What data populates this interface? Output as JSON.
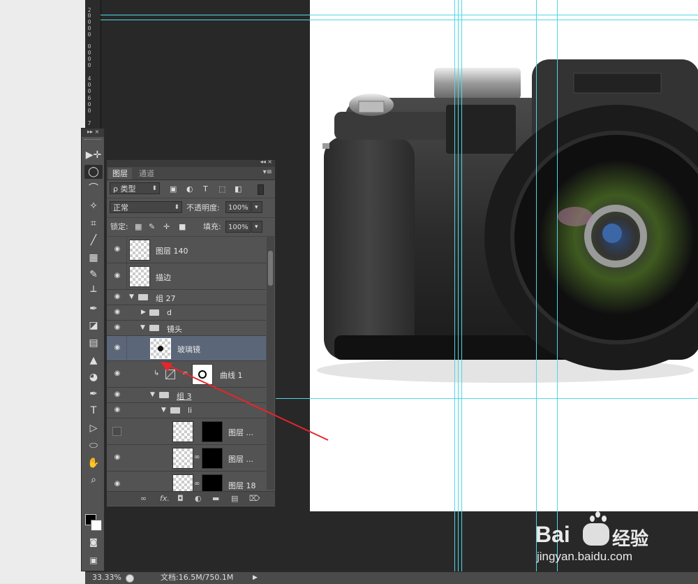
{
  "ruler": {
    "ticks": [
      "2",
      "0",
      "0",
      "0",
      "0",
      "0",
      "0",
      "0",
      "0",
      "4",
      "0",
      "0",
      "6",
      "0",
      "0",
      "7"
    ]
  },
  "tools_panel": {
    "header": "▸▸ ×",
    "tools": [
      {
        "name": "move-tool",
        "glyph": "▶✛"
      },
      {
        "name": "elliptical-marquee-tool",
        "glyph": "◯"
      },
      {
        "name": "lasso-tool",
        "glyph": "⌒"
      },
      {
        "name": "quick-selection-tool",
        "glyph": "✧"
      },
      {
        "name": "crop-tool",
        "glyph": "⌗"
      },
      {
        "name": "eyedropper-tool",
        "glyph": "╱"
      },
      {
        "name": "spot-healing-tool",
        "glyph": "▦"
      },
      {
        "name": "brush-tool",
        "glyph": "✎"
      },
      {
        "name": "clone-stamp-tool",
        "glyph": "┴"
      },
      {
        "name": "history-brush-tool",
        "glyph": "✒"
      },
      {
        "name": "eraser-tool",
        "glyph": "◪"
      },
      {
        "name": "gradient-tool",
        "glyph": "▤"
      },
      {
        "name": "blur-tool",
        "glyph": "▲"
      },
      {
        "name": "dodge-tool",
        "glyph": "◕"
      },
      {
        "name": "pen-tool",
        "glyph": "✒"
      },
      {
        "name": "type-tool",
        "glyph": "T"
      },
      {
        "name": "path-selection-tool",
        "glyph": "▷"
      },
      {
        "name": "ellipse-tool",
        "glyph": "⬭"
      },
      {
        "name": "hand-tool",
        "glyph": "✋"
      },
      {
        "name": "zoom-tool",
        "glyph": "⌕"
      }
    ]
  },
  "layers_panel": {
    "collapse": "◂◂ ×",
    "tabs": [
      "图层",
      "通道"
    ],
    "menu": "▾≡",
    "filter": {
      "label": "ρ 类型",
      "arrow": "⬍"
    },
    "filter_icons": [
      "▣",
      "◐",
      "T",
      "⬚",
      "◧"
    ],
    "blend_mode": "正常",
    "opacity_label": "不透明度:",
    "opacity": "100%",
    "lock_label": "锁定:",
    "lock_icons": [
      "▦",
      "✎",
      "✛",
      "■"
    ],
    "fill_label": "填充:",
    "fill": "100%",
    "dropdown_arrow": "▾",
    "eye_glyph": "◉",
    "link_glyph": "∞",
    "clip_glyph": "↳",
    "layers": [
      {
        "id": "layer-140",
        "name": "图层 140"
      },
      {
        "id": "stroke",
        "name": "描边"
      },
      {
        "id": "group-27",
        "name": "组 27",
        "arrow": "▼"
      },
      {
        "id": "d",
        "name": "d",
        "arrow": "▶"
      },
      {
        "id": "lens",
        "name": "镜头",
        "arrow": "▼"
      },
      {
        "id": "glass",
        "name": "玻璃镜"
      },
      {
        "id": "curves-1",
        "name": "曲线 1"
      },
      {
        "id": "group-3",
        "name": "组 3",
        "arrow": "▼"
      },
      {
        "id": "li",
        "name": "li",
        "arrow": "▼"
      },
      {
        "id": "layer-a",
        "name": "图层 ..."
      },
      {
        "id": "layer-b",
        "name": "图层 ..."
      },
      {
        "id": "layer-18",
        "name": "图层 18"
      }
    ],
    "bottom_icons": [
      {
        "name": "link-layers-icon",
        "glyph": "∞"
      },
      {
        "name": "fx-icon",
        "glyph": "fx."
      },
      {
        "name": "add-mask-icon",
        "glyph": "◘"
      },
      {
        "name": "adjustment-layer-icon",
        "glyph": "◐"
      },
      {
        "name": "new-group-icon",
        "glyph": "▬"
      },
      {
        "name": "new-layer-icon",
        "glyph": "▤"
      },
      {
        "name": "delete-layer-icon",
        "glyph": "⌦"
      }
    ]
  },
  "status": {
    "zoom": "33.33%",
    "doc": "文档:16.5M/750.1M",
    "arrow": "▶"
  },
  "watermark": {
    "brand": "Bai",
    "brand_cn": "经验",
    "url": "jingyan.baidu.com"
  }
}
